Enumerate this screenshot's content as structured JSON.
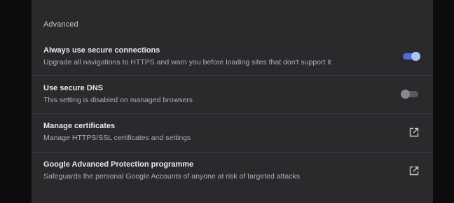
{
  "section": {
    "title": "Advanced"
  },
  "rows": [
    {
      "title": "Always use secure connections",
      "description": "Upgrade all navigations to HTTPS and warn you before loading sites that don't support it",
      "control": "toggle",
      "enabled": true
    },
    {
      "title": "Use secure DNS",
      "description": "This setting is disabled on managed browsers",
      "control": "toggle",
      "enabled": false
    },
    {
      "title": "Manage certificates",
      "description": "Manage HTTPS/SSL certificates and settings",
      "control": "open-in-new-icon"
    },
    {
      "title": "Google Advanced Protection programme",
      "description": "Safeguards the personal Google Accounts of anyone at risk of targeted attacks",
      "control": "open-in-new-icon"
    }
  ],
  "colors": {
    "panel_bg": "#2a2a2d",
    "toggle_on": "#4f6fd0",
    "toggle_off": "#5a5a5e"
  }
}
